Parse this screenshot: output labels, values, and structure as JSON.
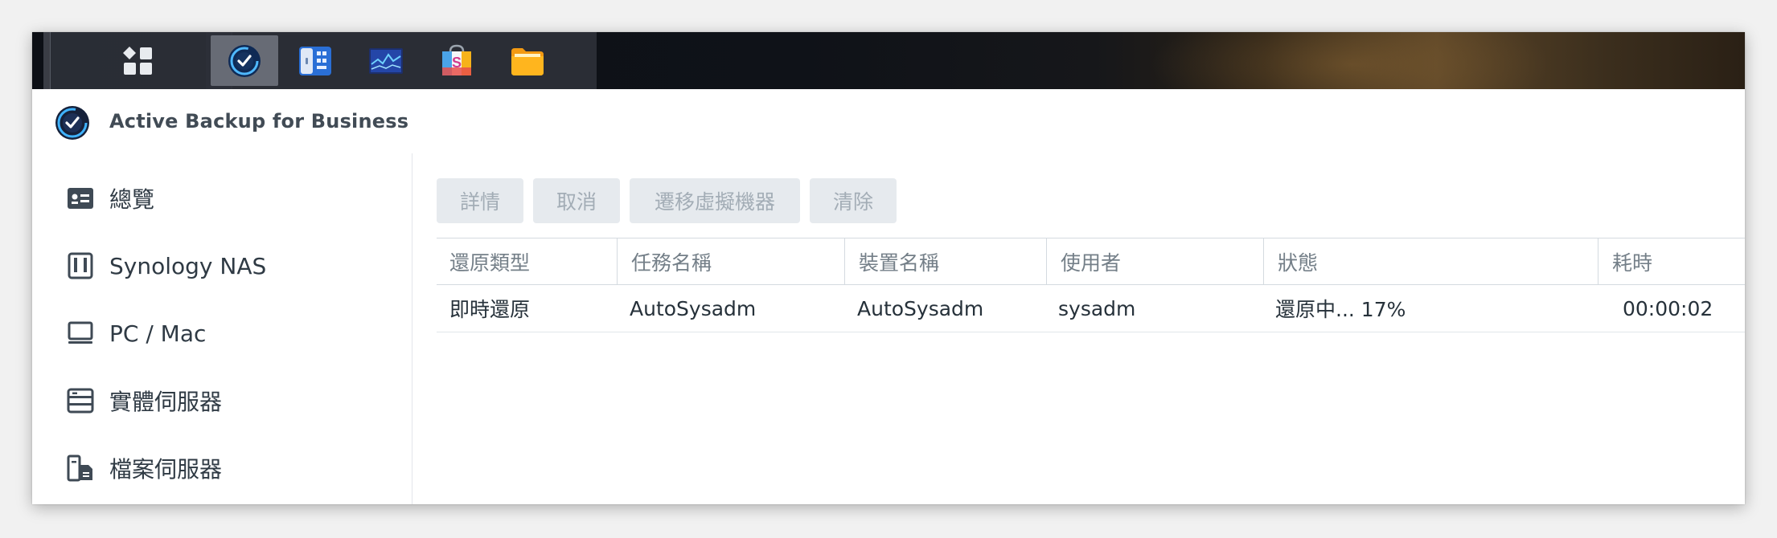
{
  "app": {
    "title": "Active Backup for Business"
  },
  "taskbar": {
    "buttons": [
      {
        "icon": "main-menu-grid-icon",
        "active": false
      },
      {
        "icon": "active-backup-icon",
        "active": true
      },
      {
        "icon": "storage-manager-icon",
        "active": false
      },
      {
        "icon": "resource-monitor-icon",
        "active": false
      },
      {
        "icon": "package-center-icon",
        "active": false
      },
      {
        "icon": "file-station-icon",
        "active": false
      }
    ]
  },
  "sidebar": {
    "items": [
      {
        "label": "總覽",
        "icon": "overview-card-icon"
      },
      {
        "label": "Synology NAS",
        "icon": "nas-device-icon"
      },
      {
        "label": "PC / Mac",
        "icon": "monitor-icon"
      },
      {
        "label": "實體伺服器",
        "icon": "server-rack-icon"
      },
      {
        "label": "檔案伺服器",
        "icon": "file-server-icon"
      }
    ]
  },
  "toolbar": {
    "details_label": "詳情",
    "cancel_label": "取消",
    "migrate_vm_label": "遷移虛擬機器",
    "clear_label": "清除"
  },
  "table": {
    "columns": [
      "還原類型",
      "任務名稱",
      "裝置名稱",
      "使用者",
      "狀態",
      "耗時"
    ],
    "rows": [
      [
        "即時還原",
        "AutoSysadm",
        "AutoSysadm",
        "sysadm",
        "還原中... 17%",
        "00:00:02"
      ]
    ]
  },
  "colors": {
    "accent": "#1f5fb8",
    "text_primary": "#26313a",
    "text_header": "#747f88",
    "button_disabled_bg": "#e6eaee",
    "button_disabled_text": "#a3adb6"
  }
}
